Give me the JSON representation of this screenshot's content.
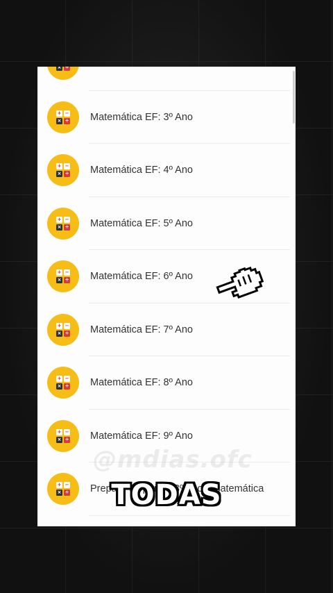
{
  "list": {
    "items": [
      {
        "label": ""
      },
      {
        "label": "Matemática EF: 3º Ano"
      },
      {
        "label": "Matemática EF: 4º Ano"
      },
      {
        "label": "Matemática EF: 5º Ano"
      },
      {
        "label": "Matemática EF: 6º Ano"
      },
      {
        "label": "Matemática EF: 7º Ano"
      },
      {
        "label": "Matemática EF: 8º Ano"
      },
      {
        "label": "Matemática EF: 9º Ano"
      },
      {
        "label": "Prepare-se para o 3º ano - Matemática"
      },
      {
        "label": ""
      }
    ],
    "icon": {
      "name": "math-operations-icon",
      "symbols": [
        "+",
        "−",
        "×",
        "÷"
      ],
      "color": "#f5bd16"
    }
  },
  "overlay": {
    "watermark": "@mdias.ofc",
    "caption": "TODAS",
    "cursor_icon": "pointing-hand-cursor-icon"
  }
}
